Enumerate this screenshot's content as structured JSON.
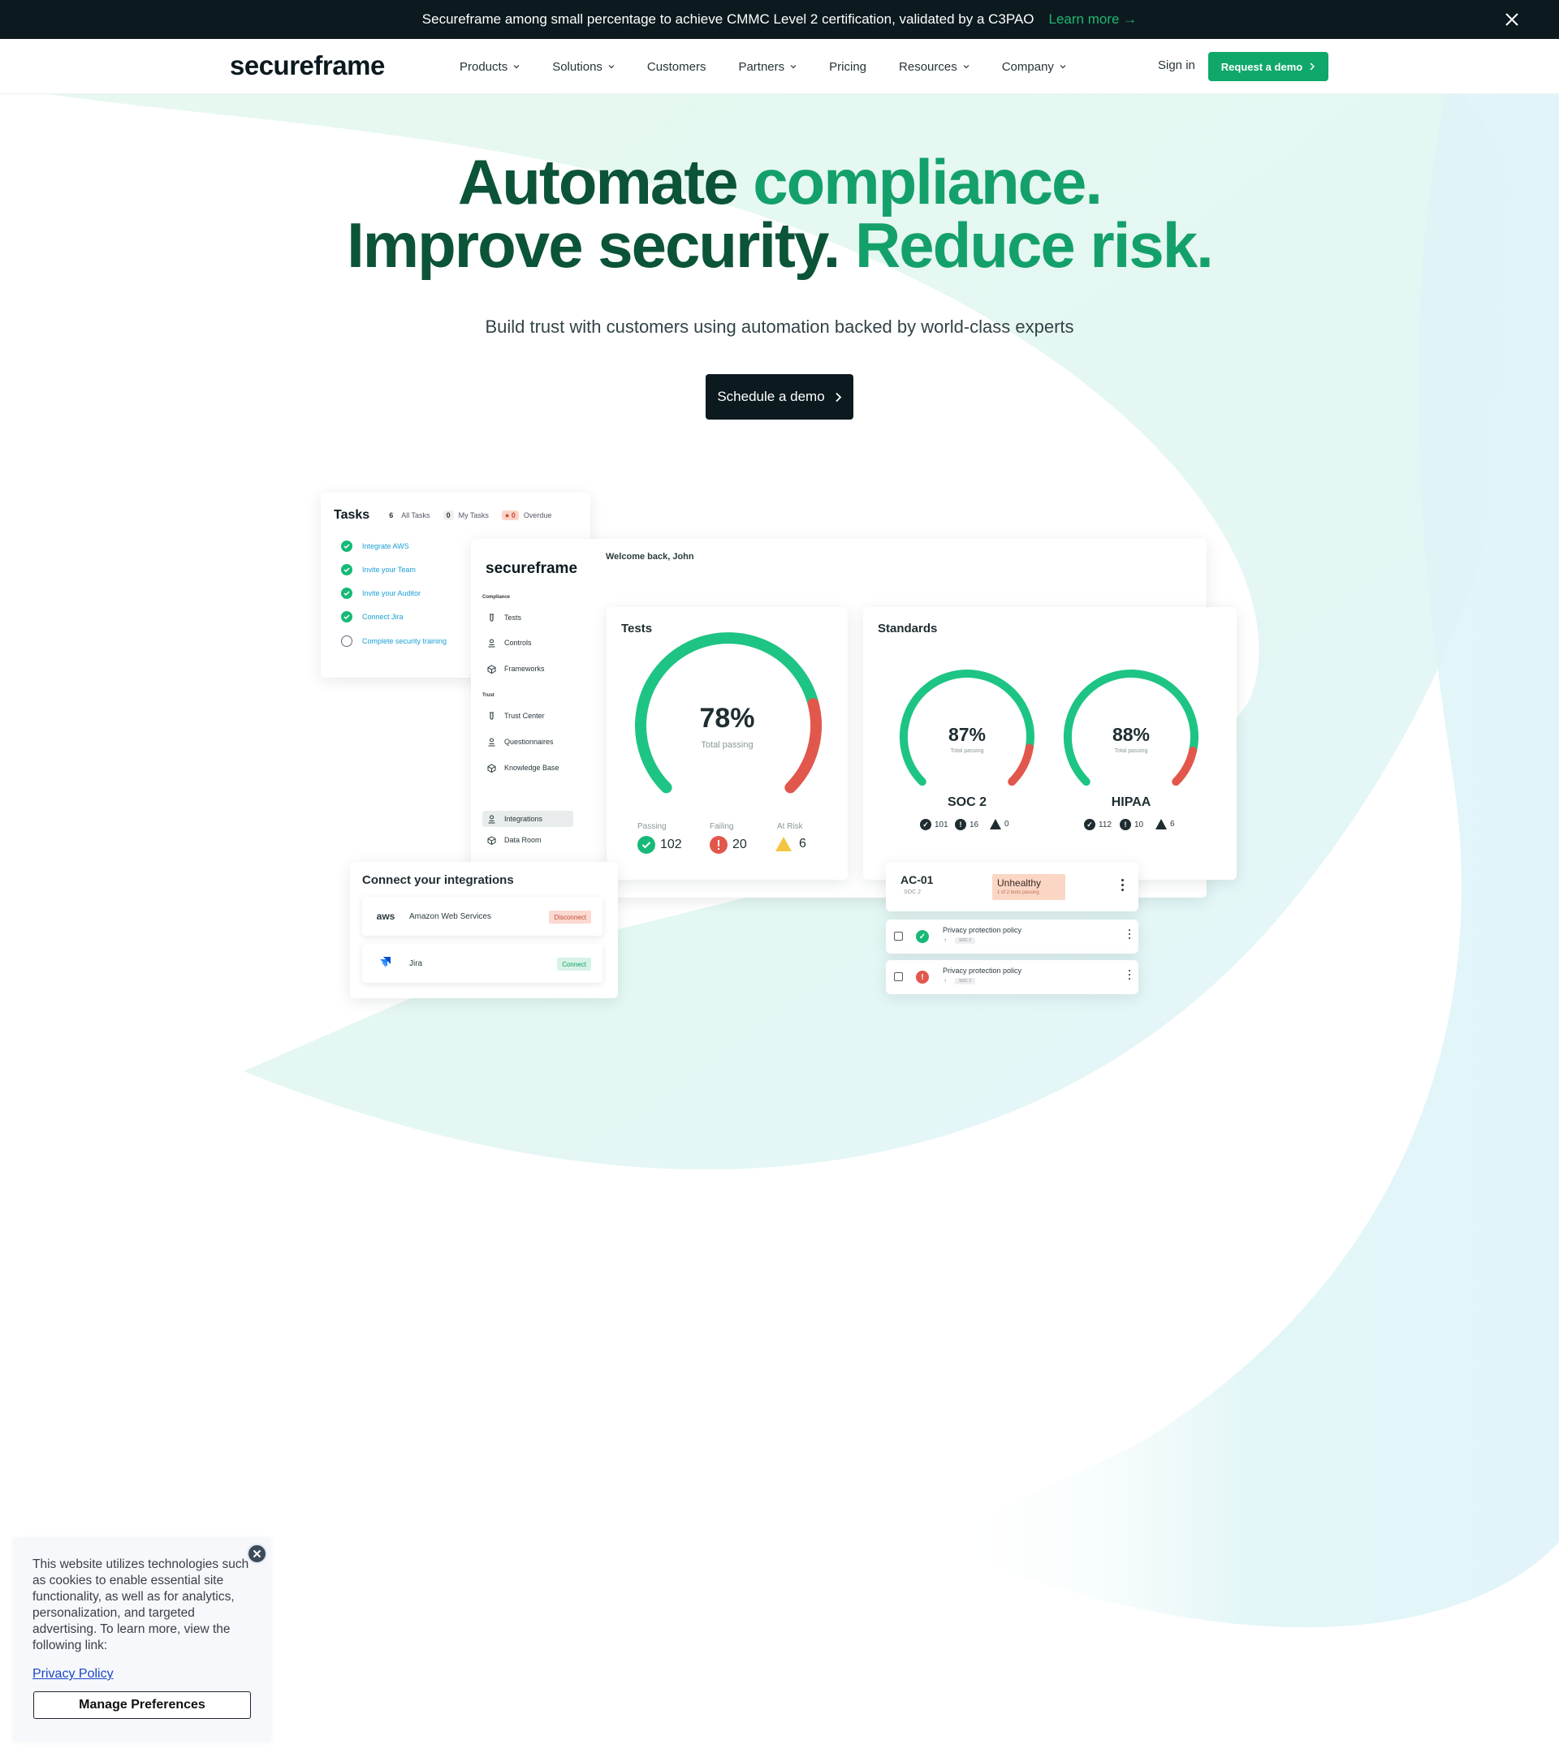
{
  "announcement": {
    "text": "Secureframe among small percentage to achieve CMMC Level 2 certification, validated by a C3PAO",
    "link": "Learn more →"
  },
  "nav": {
    "logo": "secureframe",
    "links": [
      {
        "label": "Products"
      },
      {
        "label": "Solutions"
      },
      {
        "label": "Customers"
      },
      {
        "label": "Partners"
      },
      {
        "label": "Pricing"
      },
      {
        "label": "Resources"
      },
      {
        "label": "Company"
      }
    ],
    "sign_in": "Sign in",
    "request_demo": "Request a demo"
  },
  "hero": {
    "line1a": "Automate ",
    "line1b": "compliance.",
    "line2a": "Improve security. ",
    "line2b": "Reduce risk.",
    "subtitle": "Build trust with customers using automation backed by world-class experts",
    "cta": "Schedule a demo"
  },
  "tasks": {
    "title": "Tasks",
    "all_count": "6",
    "all_label": "All Tasks",
    "my_count": "0",
    "my_label": "My Tasks",
    "overdue_count": "0",
    "overdue_label": "Overdue",
    "items": [
      {
        "label": "Integrate AWS",
        "done": true
      },
      {
        "label": "Invite your Team",
        "done": true
      },
      {
        "label": "Invite your Auditor",
        "done": true
      },
      {
        "label": "Connect Jira",
        "done": true
      },
      {
        "label": "Complete security training",
        "done": false
      }
    ]
  },
  "app": {
    "logo": "secureframe",
    "welcome": "Welcome back, John",
    "section_compliance": "Compliance",
    "section_trust": "Trust",
    "sidebar": [
      {
        "label": "Tests",
        "icon": "flask-icon"
      },
      {
        "label": "Controls",
        "icon": "controls-icon"
      },
      {
        "label": "Frameworks",
        "icon": "cube-icon"
      },
      {
        "label": "Trust Center",
        "icon": "flask-icon"
      },
      {
        "label": "Questionnaires",
        "icon": "controls-icon"
      },
      {
        "label": "Knowledge Base",
        "icon": "cube-icon"
      },
      {
        "label": "Integrations",
        "icon": "controls-icon"
      },
      {
        "label": "Data Room",
        "icon": "cube-icon"
      }
    ]
  },
  "tests": {
    "title": "Tests",
    "percent_label": "78%",
    "percent": 78,
    "sub": "Total passing",
    "passing_label": "Passing",
    "passing": "102",
    "failing_label": "Failing",
    "failing": "20",
    "risk_label": "At Risk",
    "risk": "6"
  },
  "standards": {
    "title": "Standards",
    "items": [
      {
        "name": "SOC 2",
        "percent_label": "87%",
        "percent": 87,
        "sub": "Total passing",
        "pass": "101",
        "fail": "16",
        "risk": "0"
      },
      {
        "name": "HIPAA",
        "percent_label": "88%",
        "percent": 88,
        "sub": "Total passing",
        "pass": "112",
        "fail": "10",
        "risk": "6"
      }
    ]
  },
  "integrations": {
    "title": "Connect your integrations",
    "items": [
      {
        "logo": "aws",
        "name": "Amazon Web Services",
        "action": "Disconnect"
      },
      {
        "logo": "jira-icon",
        "name": "Jira",
        "action": "Connect"
      }
    ]
  },
  "control": {
    "id": "AC-01",
    "framework": "SOC 2",
    "status": "Unhealthy",
    "status_sub": "1 of 2 tests passing"
  },
  "policies": [
    {
      "name": "Privacy protection policy",
      "tag": "SOC 2",
      "status": "pass"
    },
    {
      "name": "Privacy protection policy",
      "tag": "SOC 2",
      "status": "fail"
    }
  ],
  "cookie": {
    "text": "This website utilizes technologies such as cookies to enable essential site functionality, as well as for analytics, personalization, and targeted advertising. To learn more, view the following link:",
    "link": "Privacy Policy",
    "button": "Manage Preferences"
  },
  "colors": {
    "brand_green": "#14a06a",
    "dark": "#0c1a1f",
    "fail_red": "#e2574c",
    "warn_yellow": "#f4c542"
  }
}
